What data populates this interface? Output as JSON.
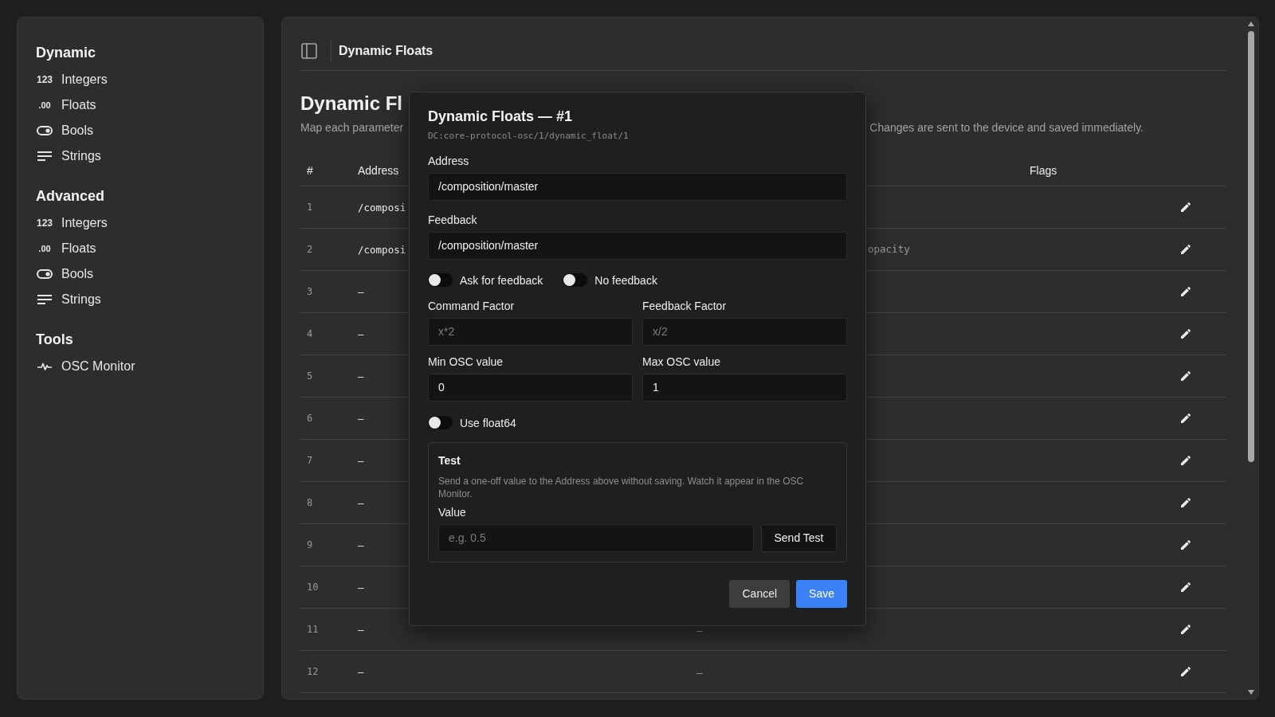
{
  "sidebar": {
    "sections": [
      {
        "title": "Dynamic",
        "items": [
          {
            "label": "Integers",
            "icon": {
              "kind": "digits",
              "text": "123"
            }
          },
          {
            "label": "Floats",
            "icon": {
              "kind": "decimal",
              "text": ".00"
            }
          },
          {
            "label": "Bools",
            "icon": {
              "kind": "toggle"
            }
          },
          {
            "label": "Strings",
            "icon": {
              "kind": "lines"
            }
          }
        ]
      },
      {
        "title": "Advanced",
        "items": [
          {
            "label": "Integers",
            "icon": {
              "kind": "digits",
              "text": "123"
            }
          },
          {
            "label": "Floats",
            "icon": {
              "kind": "decimal",
              "text": ".00"
            }
          },
          {
            "label": "Bools",
            "icon": {
              "kind": "toggle"
            }
          },
          {
            "label": "Strings",
            "icon": {
              "kind": "lines"
            }
          }
        ]
      },
      {
        "title": "Tools",
        "items": [
          {
            "label": "OSC Monitor",
            "icon": {
              "kind": "pulse"
            }
          }
        ]
      }
    ]
  },
  "header": {
    "title": "Dynamic Floats"
  },
  "page": {
    "title": "Dynamic Fl",
    "description_start": "Map each parameter",
    "description_end": "Changes are sent to the device and saved immediately."
  },
  "table": {
    "columns": {
      "number": "#",
      "address": "Address",
      "flags": "Flags"
    },
    "rows": [
      {
        "number": "1",
        "address": "/composi"
      },
      {
        "number": "2",
        "address": "/composi",
        "column_3_end": "opacity"
      },
      {
        "number": "3",
        "address": "–"
      },
      {
        "number": "4",
        "address": "–"
      },
      {
        "number": "5",
        "address": "–"
      },
      {
        "number": "6",
        "address": "–"
      },
      {
        "number": "7",
        "address": "–"
      },
      {
        "number": "8",
        "address": "–"
      },
      {
        "number": "9",
        "address": "–"
      },
      {
        "number": "10",
        "address": "–"
      },
      {
        "number": "11",
        "address": "–",
        "column_3": "–"
      },
      {
        "number": "12",
        "address": "–",
        "column_3": "–"
      }
    ]
  },
  "dialog": {
    "title": "Dynamic Floats — #1",
    "path": "DC:core-protocol-osc/1/dynamic_float/1",
    "address": {
      "label": "Address",
      "value": "/composition/master"
    },
    "feedback": {
      "label": "Feedback",
      "value": "/composition/master"
    },
    "toggles": [
      {
        "label": "Ask for feedback",
        "on": false
      },
      {
        "label": "No feedback",
        "on": false
      }
    ],
    "factors": [
      {
        "label": "Command Factor",
        "placeholder": "x*2"
      },
      {
        "label": "Feedback Factor",
        "placeholder": "x/2"
      }
    ],
    "range": [
      {
        "label": "Min OSC value",
        "value": "0"
      },
      {
        "label": "Max OSC value",
        "value": "1"
      }
    ],
    "float64": {
      "label": "Use float64",
      "on": false
    },
    "test": {
      "title": "Test",
      "hint": "Send a one-off value to the Address above without saving. Watch it appear in the OSC Monitor.",
      "value_label": "Value",
      "placeholder": "e.g. 0.5",
      "button": "Send Test"
    },
    "buttons": [
      {
        "label": "Cancel",
        "kind": "secondary"
      },
      {
        "label": "Save",
        "kind": "primary"
      }
    ]
  }
}
